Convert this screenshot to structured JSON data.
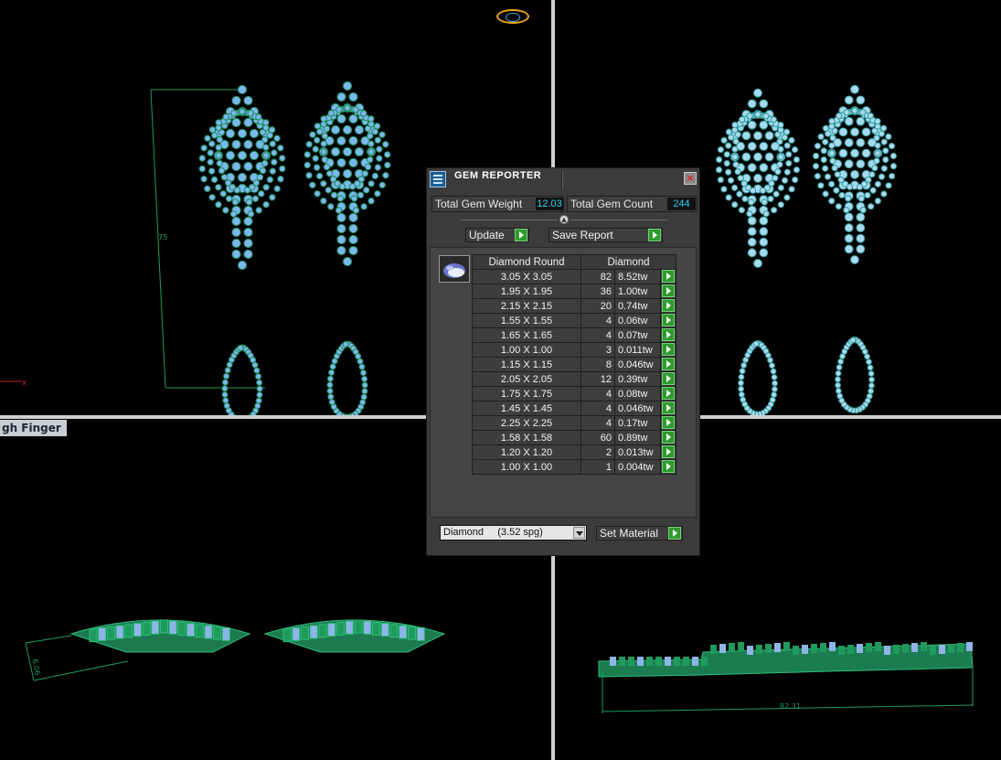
{
  "viewport": {
    "bottom_left_label": "gh Finger",
    "front_dimension": "6.06",
    "right_dimension": "82.31",
    "top_dimension": "75"
  },
  "panel": {
    "title": "GEM REPORTER",
    "close_glyph": "×",
    "total_weight_label": "Total Gem Weight",
    "total_weight_value": "12.03",
    "total_count_label": "Total Gem Count",
    "total_count_value": "244",
    "update_label": "Update",
    "save_report_label": "Save Report",
    "table": {
      "header_shape": "Diamond Round",
      "header_material": "Diamond",
      "rows": [
        {
          "size": "3.05 X 3.05",
          "count": "82",
          "weight": "8.52tw"
        },
        {
          "size": "1.95 X 1.95",
          "count": "36",
          "weight": "1.00tw"
        },
        {
          "size": "2.15 X 2.15",
          "count": "20",
          "weight": "0.74tw"
        },
        {
          "size": "1.55 X 1.55",
          "count": "4",
          "weight": "0.06tw"
        },
        {
          "size": "1.65 X 1.65",
          "count": "4",
          "weight": "0.07tw"
        },
        {
          "size": "1.00 X 1.00",
          "count": "3",
          "weight": "0.011tw"
        },
        {
          "size": "1.15 X 1.15",
          "count": "8",
          "weight": "0.046tw"
        },
        {
          "size": "2.05 X 2.05",
          "count": "12",
          "weight": "0.39tw"
        },
        {
          "size": "1.75 X 1.75",
          "count": "4",
          "weight": "0.08tw"
        },
        {
          "size": "1.45 X 1.45",
          "count": "4",
          "weight": "0.046tw"
        },
        {
          "size": "2.25 X 2.25",
          "count": "4",
          "weight": "0.17tw"
        },
        {
          "size": "1.58 X 1.58",
          "count": "60",
          "weight": "0.89tw"
        },
        {
          "size": "1.20 X 1.20",
          "count": "2",
          "weight": "0.013tw"
        },
        {
          "size": "1.00 X 1.00",
          "count": "1",
          "weight": "0.004tw"
        }
      ]
    },
    "material_select": "Diamond     (3.52 spg)",
    "set_material_label": "Set Material"
  },
  "colors": {
    "gem_blue": "#7ab8ee",
    "metal_green": "#1c8a55",
    "value_cyan": "#2ad2f0",
    "go_green": "#2e9b2e"
  }
}
